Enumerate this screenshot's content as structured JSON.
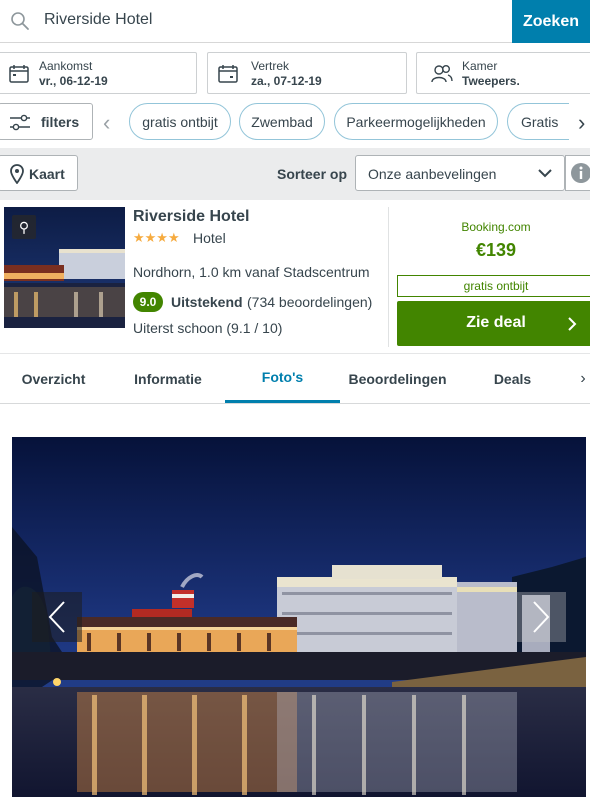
{
  "search": {
    "query": "Riverside Hotel",
    "button_label": "Zoeken"
  },
  "dates": {
    "checkin": {
      "label": "Aankomst",
      "value": "vr., 06-12-19"
    },
    "checkout": {
      "label": "Vertrek",
      "value": "za., 07-12-19"
    },
    "room": {
      "label": "Kamer",
      "value": "Tweepers."
    }
  },
  "filters": {
    "button_label": "filters",
    "chips": [
      "gratis ontbijt",
      "Zwembad",
      "Parkeermogelijkheden",
      "Gratis"
    ]
  },
  "sort": {
    "map_label": "Kaart",
    "label": "Sorteer op",
    "selected": "Onze aanbevelingen"
  },
  "hotel": {
    "name": "Riverside Hotel",
    "stars": "★★★★",
    "type": "Hotel",
    "location": "Nordhorn, 1.0 km vanaf Stadscentrum",
    "rating": "9.0",
    "rating_word": "Uitstekend",
    "rating_count": "(734 beoordelingen)",
    "cleanliness": "Uiterst schoon (9.1 / 10)",
    "provider": "Booking.com",
    "price": "€139",
    "perk": "gratis ontbijt",
    "deal_label": "Zie deal"
  },
  "tabs": [
    "Overzicht",
    "Informatie",
    "Foto's",
    "Beoordelingen",
    "Deals"
  ],
  "active_tab": "Foto's",
  "colors": {
    "accent": "#007fad",
    "deal_green": "#428500",
    "star": "#f6ab3f"
  }
}
